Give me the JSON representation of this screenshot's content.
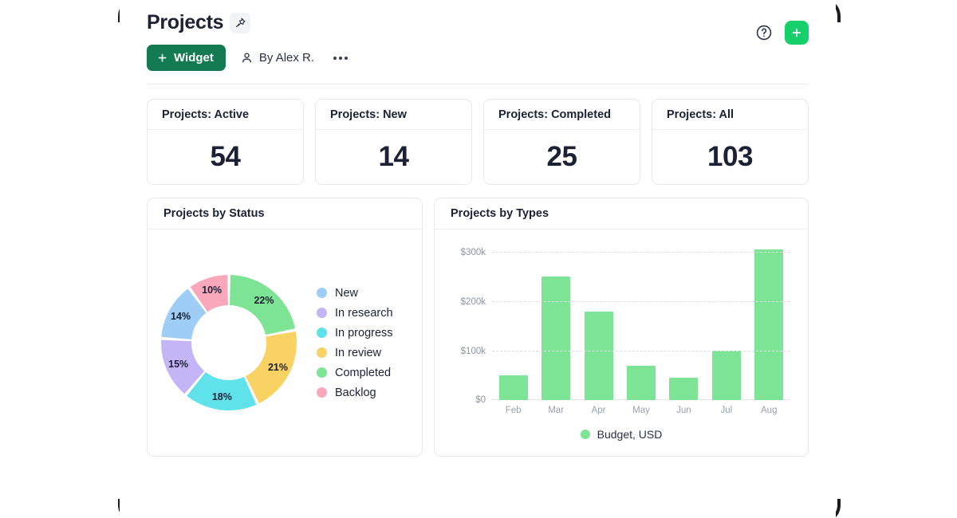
{
  "header": {
    "title": "Projects",
    "pin_icon": "pin-icon",
    "help_icon": "help-circle-icon",
    "add_icon": "plus-icon",
    "toolbar": {
      "widget_button": "Widget",
      "widget_plus_icon": "plus-icon",
      "author": "By Alex R.",
      "author_icon": "user-icon",
      "more_icon": "more-horizontal-icon"
    }
  },
  "kpis": [
    {
      "label": "Projects: Active",
      "value": "54"
    },
    {
      "label": "Projects: New",
      "value": "14"
    },
    {
      "label": "Projects: Completed",
      "value": "25"
    },
    {
      "label": "Projects: All",
      "value": "103"
    }
  ],
  "panels": {
    "status_title": "Projects by Status",
    "types_title": "Projects by Types"
  },
  "chart_data": [
    {
      "type": "pie",
      "title": "Projects by Status",
      "legend_position": "right",
      "hole": 0.55,
      "categories": [
        "Completed",
        "In review",
        "In progress",
        "In research",
        "New",
        "Backlog"
      ],
      "values": [
        22,
        21,
        18,
        15,
        14,
        10
      ],
      "data_labels": [
        "22%",
        "21%",
        "18%",
        "15%",
        "14%",
        "10%"
      ],
      "colors": [
        "#7ee495",
        "#f9d264",
        "#5fe2ea",
        "#c4b5f7",
        "#9ecdf5",
        "#f9a8bb"
      ],
      "legend": [
        {
          "label": "New",
          "color": "#9ecdf5"
        },
        {
          "label": "In research",
          "color": "#c4b5f7"
        },
        {
          "label": "In progress",
          "color": "#5fe2ea"
        },
        {
          "label": "In review",
          "color": "#f9d264"
        },
        {
          "label": "Completed",
          "color": "#7ee495"
        },
        {
          "label": "Backlog",
          "color": "#f9a8bb"
        }
      ]
    },
    {
      "type": "bar",
      "title": "Projects by Types",
      "categories": [
        "Feb",
        "Mar",
        "Apr",
        "May",
        "Jun",
        "Jul",
        "Aug"
      ],
      "values": [
        50000,
        250000,
        180000,
        70000,
        45000,
        100000,
        305000
      ],
      "series_name": "Budget, USD",
      "series_color": "#7ee495",
      "xlabel": "",
      "ylabel": "",
      "ylim": [
        0,
        320000
      ],
      "yticks": [
        0,
        100000,
        200000,
        300000
      ],
      "ytick_labels": [
        "$0",
        "$100k",
        "$200k",
        "$300k"
      ],
      "grid": true,
      "legend_position": "bottom",
      "legend_label": "Budget, USD"
    }
  ]
}
